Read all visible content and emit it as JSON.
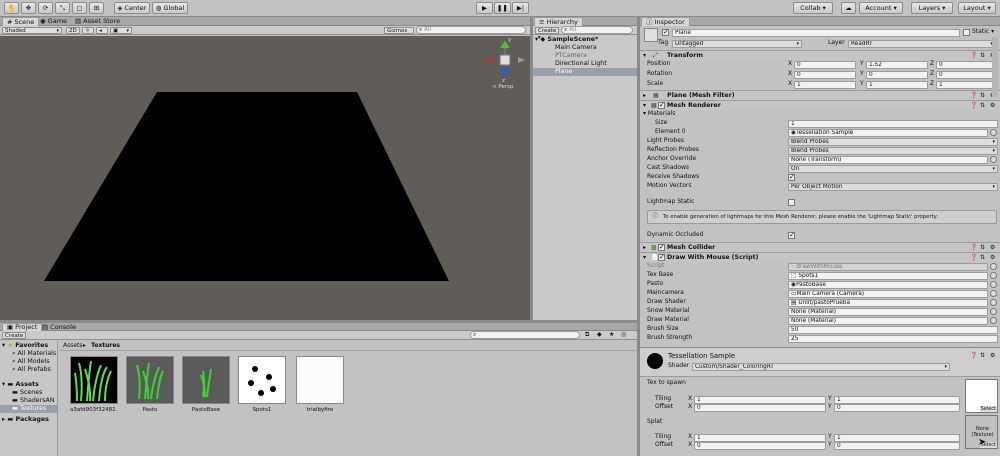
{
  "toolbar": {
    "center_label": "Center",
    "global_label": "Global",
    "collab_label": "Collab ▾",
    "account_label": "Account ▾",
    "layers_label": "Layers ▾",
    "layout_label": "Layout ▾"
  },
  "scene_tabs": [
    "Scene",
    "Game",
    "Asset Store"
  ],
  "scene_toolbar": {
    "shading": "Shaded",
    "mode_2d": "2D",
    "gizmos": "Gizmos ▾",
    "search_placeholder": "All"
  },
  "gizmo": {
    "y": "y",
    "z": "z",
    "persp": "< Persp"
  },
  "hierarchy": {
    "tab": "Hierarchy",
    "create": "Create ▾",
    "search_placeholder": "All",
    "scene": "SampleScene*",
    "items": [
      "Main Camera",
      "PTCamera",
      "Directional Light",
      "Plane"
    ]
  },
  "inspector": {
    "tab": "Inspector",
    "object_name": "Plane",
    "static_label": "Static ▾",
    "tag_label": "Tag",
    "tag_value": "Untagged",
    "layer_label": "Layer",
    "layer_value": "ReadRT",
    "transform": {
      "title": "Transform",
      "rows": [
        {
          "label": "Position",
          "x": "0",
          "y": "1.52",
          "z": "0"
        },
        {
          "label": "Rotation",
          "x": "0",
          "y": "0",
          "z": "0"
        },
        {
          "label": "Scale",
          "x": "1",
          "y": "1",
          "z": "1"
        }
      ]
    },
    "mesh_filter": {
      "title": "Plane (Mesh Filter)"
    },
    "mesh_renderer": {
      "title": "Mesh Renderer",
      "materials_label": "Materials",
      "size_label": "Size",
      "size_value": "1",
      "element0_label": "Element 0",
      "element0_value": "Tessellation Sample",
      "light_probes_label": "Light Probes",
      "light_probes_value": "Blend Probes",
      "reflection_label": "Reflection Probes",
      "reflection_value": "Blend Probes",
      "anchor_label": "Anchor Override",
      "anchor_value": "None (Transform)",
      "cast_label": "Cast Shadows",
      "cast_value": "On",
      "receive_label": "Receive Shadows",
      "motion_label": "Motion Vectors",
      "motion_value": "Per Object Motion",
      "lightmap_label": "Lightmap Static",
      "info_text": "To enable generation of lightmaps for this Mesh Renderer, please enable the 'Lightmap Static' property.",
      "occluded_label": "Dynamic Occluded"
    },
    "mesh_collider": {
      "title": "Mesh Collider"
    },
    "draw_script": {
      "title": "Draw With Mouse (Script)",
      "rows": [
        {
          "label": "Script",
          "value": "drawWithMouse"
        },
        {
          "label": "Tex Base",
          "value": "Spots1"
        },
        {
          "label": "Pasto",
          "value": "PastoBase"
        },
        {
          "label": "Maincamera",
          "value": "Main Camera (Camera)"
        },
        {
          "label": "Draw Shader",
          "value": "Unlit/pastoPrueba"
        },
        {
          "label": "Snow Material",
          "value": "None (Material)"
        },
        {
          "label": "Draw Material",
          "value": "None (Material)"
        },
        {
          "label": "Brush Size",
          "value": "50"
        },
        {
          "label": "Brush Strength",
          "value": "25"
        }
      ]
    },
    "material": {
      "name": "Tessellation Sample",
      "shader_label": "Shader",
      "shader_value": "Custom/Shader_ColoringRT",
      "tex_spawn_label": "Tex to spawn",
      "splat_label": "Splat",
      "tiling_label": "Tiling",
      "offset_label": "Offset",
      "tex_tiling": {
        "x": "1",
        "y": "1"
      },
      "tex_offset": {
        "x": "0",
        "y": "0"
      },
      "splat_tiling": {
        "x": "1",
        "y": "1"
      },
      "splat_offset": {
        "x": "0",
        "y": "0"
      },
      "select_label": "Select",
      "none_texture_label": "None (Texture)",
      "select2_label": "Select"
    }
  },
  "project": {
    "tabs": [
      "Project",
      "Console"
    ],
    "create": "Create ▾",
    "favorites": "Favorites",
    "fav_items": [
      "All Materials",
      "All Models",
      "All Prefabs"
    ],
    "assets": "Assets",
    "asset_items": [
      "Scenes",
      "ShadersAN",
      "Textures"
    ],
    "packages": "Packages",
    "breadcrumb": [
      "Assets",
      "Textures"
    ],
    "files": [
      "a3afd903f32482...",
      "Pasto",
      "PastoBase",
      "Spots1",
      "trialbyfire"
    ]
  }
}
